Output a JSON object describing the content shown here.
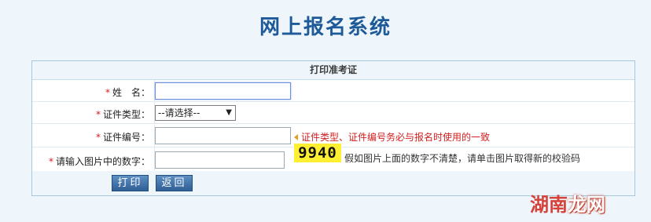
{
  "page_title": "网上报名系统",
  "panel": {
    "header": "打印准考证",
    "fields": {
      "name": {
        "label": "姓　名：",
        "required_mark": "*",
        "value": ""
      },
      "id_type": {
        "label": "证件类型：",
        "required_mark": "*",
        "selected": "--请选择--"
      },
      "id_number": {
        "label": "证件编号：",
        "required_mark": "*",
        "value": "",
        "hint": "证件类型、证件编号务必与报名时使用的一致"
      },
      "captcha": {
        "label": "请输入图片中的数字：",
        "required_mark": "*",
        "value": "",
        "image_text": "9940",
        "hint": "假如图片上面的数字不清楚，请单击图片取得新的校验码"
      }
    },
    "buttons": {
      "print": "打印",
      "back": "返回"
    }
  },
  "watermark": {
    "part1": "湖南",
    "part2": "龙网"
  },
  "colors": {
    "title": "#1f5a98",
    "required": "#d22020",
    "captcha_bg": "#ffef33",
    "button": "#3a6ea5"
  }
}
